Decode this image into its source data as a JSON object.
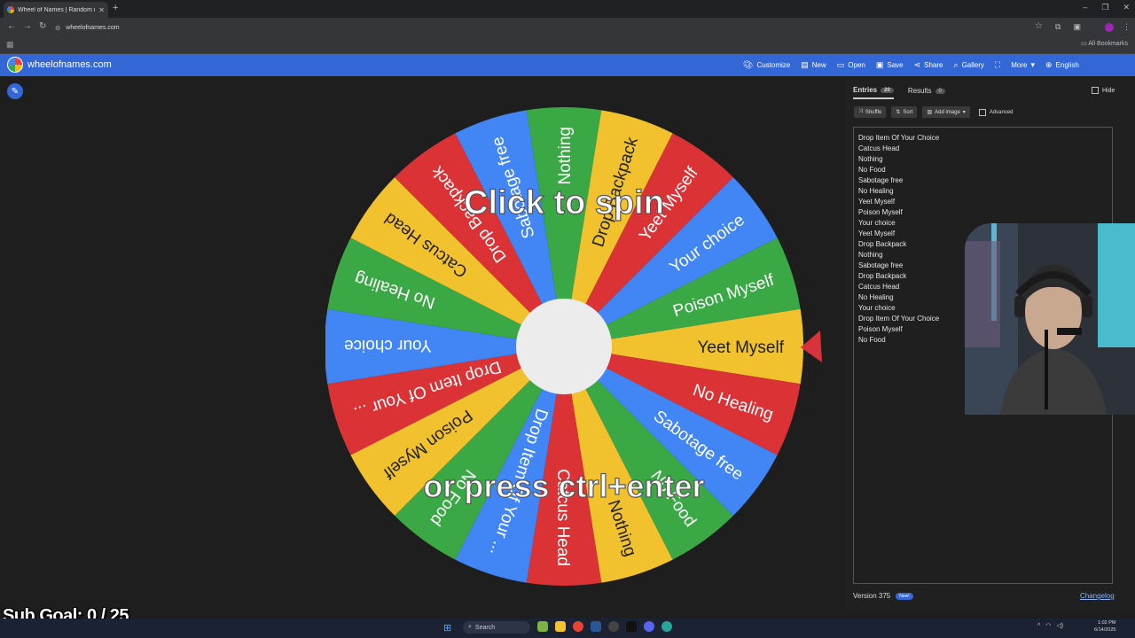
{
  "browser": {
    "tab_title": "Wheel of Names | Random nam",
    "url": "wheelofnames.com",
    "all_bookmarks": "All Bookmarks"
  },
  "header": {
    "site_name": "wheelofnames.com",
    "nav": [
      {
        "label": "Customize",
        "icon": "palette-icon"
      },
      {
        "label": "New",
        "icon": "file-icon"
      },
      {
        "label": "Open",
        "icon": "folder-icon"
      },
      {
        "label": "Save",
        "icon": "save-icon"
      },
      {
        "label": "Share",
        "icon": "share-icon"
      },
      {
        "label": "Gallery",
        "icon": "search-icon"
      },
      {
        "label": "",
        "icon": "fullscreen-icon"
      },
      {
        "label": "More",
        "icon": "chevron-down-icon"
      },
      {
        "label": "English",
        "icon": "globe-icon"
      }
    ]
  },
  "wheel": {
    "overlay_top": "Click to spin",
    "overlay_bottom": "or press ctrl+enter",
    "colors": {
      "green": "#3aa845",
      "yellow": "#f2c12e",
      "red": "#db3236",
      "blue": "#4285f4"
    },
    "segments": [
      {
        "label": "Nothing",
        "color": "green"
      },
      {
        "label": "Drop Backpack",
        "color": "yellow"
      },
      {
        "label": "Yeet Myself",
        "color": "red"
      },
      {
        "label": "Your choice",
        "color": "blue"
      },
      {
        "label": "Poison Myself",
        "color": "green"
      },
      {
        "label": "Yeet Myself",
        "color": "yellow"
      },
      {
        "label": "No Healing",
        "color": "red"
      },
      {
        "label": "Sabotage free",
        "color": "blue"
      },
      {
        "label": "No Food",
        "color": "green"
      },
      {
        "label": "Nothing",
        "color": "yellow"
      },
      {
        "label": "Catcus Head",
        "color": "red"
      },
      {
        "label": "Drop Item Of Your ...",
        "color": "blue"
      },
      {
        "label": "No Food",
        "color": "green"
      },
      {
        "label": "Poison Myself",
        "color": "yellow"
      },
      {
        "label": "Drop Item Of Your ...",
        "color": "red"
      },
      {
        "label": "Your choice",
        "color": "blue"
      },
      {
        "label": "No Healing",
        "color": "green"
      },
      {
        "label": "Catcus Head",
        "color": "yellow"
      },
      {
        "label": "Drop Backpack",
        "color": "red"
      },
      {
        "label": "Sabotage free",
        "color": "blue"
      }
    ]
  },
  "panel": {
    "tab_entries": "Entries",
    "entries_count": "20",
    "tab_results": "Results",
    "results_count": "0",
    "hide_label": "Hide",
    "shuffle": "Shuffle",
    "sort": "Sort",
    "add_image": "Add image",
    "advanced": "Advanced",
    "entries": [
      "Drop Item Of Your Choice",
      "Catcus Head",
      "Nothing",
      "No Food",
      "Sabotage free",
      "No Healing",
      "Yeet Myself",
      "Poison Myself",
      "Your choice",
      "Yeet Myself",
      "Drop Backpack",
      "Nothing",
      "Sabotage free",
      "Drop Backpack",
      "Catcus Head",
      "No Healing",
      "Your choice",
      "Drop Item Of Your Choice",
      "Poison Myself",
      "No Food"
    ],
    "version": "Version 375",
    "new_badge": "New!",
    "changelog": "Changelog"
  },
  "overlay": {
    "sub_goal": "Sub Goal:  0 / 25"
  },
  "taskbar": {
    "search": "Search",
    "time": "1:02 PM",
    "date": "6/14/2025"
  }
}
